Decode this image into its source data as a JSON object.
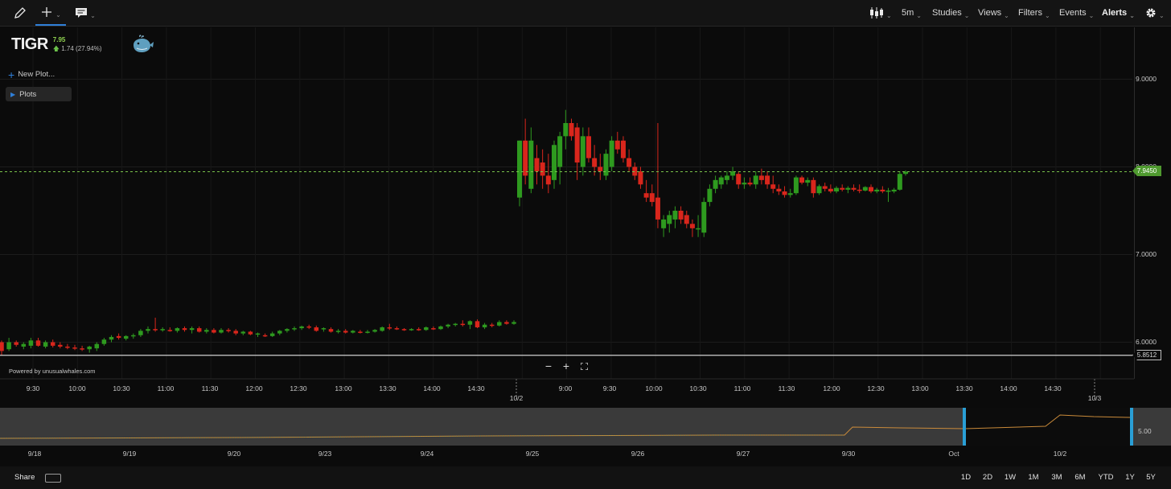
{
  "toolbar": {
    "left_tools": [
      {
        "name": "pencil-icon"
      },
      {
        "name": "crosshair-icon"
      },
      {
        "name": "comment-icon"
      }
    ],
    "interval": "5m",
    "menus": [
      "Studies",
      "Views",
      "Filters",
      "Events",
      "Alerts"
    ]
  },
  "ticker": {
    "symbol": "TIGR",
    "price": "7.95",
    "change": "1.74 (27.94%)",
    "direction": "up"
  },
  "panel": {
    "new_plot_label": "New Plot...",
    "plots_label": "Plots"
  },
  "powered_by": "Powered by unusualwhales.com",
  "zoom": {
    "minus": "−",
    "plus": "+"
  },
  "price_axis": {
    "ticks": [
      "9.0000",
      "8.0000",
      "7.0000",
      "6.0000"
    ],
    "last_price_tag": "7.9450",
    "hline_tag": "5.8512"
  },
  "time_axis": {
    "labels": [
      "9:30",
      "10:00",
      "10:30",
      "11:00",
      "11:30",
      "12:00",
      "12:30",
      "13:00",
      "13:30",
      "14:00",
      "14:30",
      "9:00",
      "9:30",
      "10:00",
      "10:30",
      "11:00",
      "11:30",
      "12:00",
      "12:30",
      "13:00",
      "13:30",
      "14:00",
      "14:30"
    ],
    "date_labels": [
      "10/2",
      "10/3"
    ]
  },
  "navigator": {
    "dates": [
      "9/18",
      "9/19",
      "9/20",
      "9/23",
      "9/24",
      "9/25",
      "9/26",
      "9/27",
      "9/30",
      "Oct",
      "10/2"
    ],
    "price_label": "5.00"
  },
  "footer": {
    "share_label": "Share",
    "ranges": [
      "1D",
      "2D",
      "1W",
      "1M",
      "3M",
      "6M",
      "YTD",
      "1Y",
      "5Y"
    ]
  },
  "colors": {
    "up": "#2e9a1f",
    "down": "#d9261c",
    "accent": "#2f7fd8",
    "last_price_line": "#79c34a"
  },
  "chart_data": {
    "type": "candlestick",
    "symbol": "TIGR",
    "interval": "5m",
    "ylim": [
      5.8,
      9.4
    ],
    "last_price": 7.945,
    "horizontal_line": 5.8512,
    "x_range_days": [
      "10/1",
      "10/2"
    ],
    "candles": [
      {
        "o": 6.0,
        "h": 6.02,
        "l": 5.85,
        "c": 5.9
      },
      {
        "o": 5.92,
        "h": 6.05,
        "l": 5.9,
        "c": 6.0
      },
      {
        "o": 6.0,
        "h": 6.02,
        "l": 5.95,
        "c": 5.97
      },
      {
        "o": 5.95,
        "h": 6.0,
        "l": 5.92,
        "c": 5.98
      },
      {
        "o": 5.96,
        "h": 6.05,
        "l": 5.93,
        "c": 6.02
      },
      {
        "o": 6.02,
        "h": 6.05,
        "l": 5.95,
        "c": 5.96
      },
      {
        "o": 5.95,
        "h": 6.02,
        "l": 5.93,
        "c": 6.0
      },
      {
        "o": 6.0,
        "h": 6.03,
        "l": 5.94,
        "c": 5.96
      },
      {
        "o": 5.97,
        "h": 6.0,
        "l": 5.93,
        "c": 5.95
      },
      {
        "o": 5.95,
        "h": 5.98,
        "l": 5.92,
        "c": 5.94
      },
      {
        "o": 5.94,
        "h": 5.97,
        "l": 5.91,
        "c": 5.93
      },
      {
        "o": 5.93,
        "h": 5.96,
        "l": 5.9,
        "c": 5.92
      },
      {
        "o": 5.92,
        "h": 5.96,
        "l": 5.88,
        "c": 5.95
      },
      {
        "o": 5.93,
        "h": 6.0,
        "l": 5.9,
        "c": 5.98
      },
      {
        "o": 5.98,
        "h": 6.05,
        "l": 5.96,
        "c": 6.03
      },
      {
        "o": 6.03,
        "h": 6.08,
        "l": 6.0,
        "c": 6.06
      },
      {
        "o": 6.07,
        "h": 6.1,
        "l": 6.03,
        "c": 6.05
      },
      {
        "o": 6.04,
        "h": 6.08,
        "l": 6.02,
        "c": 6.07
      },
      {
        "o": 6.07,
        "h": 6.1,
        "l": 6.04,
        "c": 6.08
      },
      {
        "o": 6.08,
        "h": 6.15,
        "l": 6.06,
        "c": 6.13
      },
      {
        "o": 6.13,
        "h": 6.18,
        "l": 6.1,
        "c": 6.15
      },
      {
        "o": 6.15,
        "h": 6.28,
        "l": 6.12,
        "c": 6.14
      },
      {
        "o": 6.14,
        "h": 6.17,
        "l": 6.12,
        "c": 6.15
      },
      {
        "o": 6.14,
        "h": 6.17,
        "l": 6.12,
        "c": 6.13
      },
      {
        "o": 6.13,
        "h": 6.17,
        "l": 6.11,
        "c": 6.16
      },
      {
        "o": 6.16,
        "h": 6.18,
        "l": 6.12,
        "c": 6.14
      },
      {
        "o": 6.14,
        "h": 6.18,
        "l": 6.1,
        "c": 6.16
      },
      {
        "o": 6.16,
        "h": 6.18,
        "l": 6.11,
        "c": 6.12
      },
      {
        "o": 6.12,
        "h": 6.16,
        "l": 6.1,
        "c": 6.14
      },
      {
        "o": 6.14,
        "h": 6.16,
        "l": 6.1,
        "c": 6.11
      },
      {
        "o": 6.11,
        "h": 6.16,
        "l": 6.1,
        "c": 6.14
      },
      {
        "o": 6.14,
        "h": 6.16,
        "l": 6.11,
        "c": 6.13
      },
      {
        "o": 6.13,
        "h": 6.15,
        "l": 6.08,
        "c": 6.1
      },
      {
        "o": 6.1,
        "h": 6.13,
        "l": 6.08,
        "c": 6.12
      },
      {
        "o": 6.12,
        "h": 6.13,
        "l": 6.08,
        "c": 6.09
      },
      {
        "o": 6.09,
        "h": 6.11,
        "l": 6.06,
        "c": 6.1
      },
      {
        "o": 6.08,
        "h": 6.1,
        "l": 6.06,
        "c": 6.07
      },
      {
        "o": 6.07,
        "h": 6.12,
        "l": 6.06,
        "c": 6.1
      },
      {
        "o": 6.1,
        "h": 6.14,
        "l": 6.08,
        "c": 6.13
      },
      {
        "o": 6.13,
        "h": 6.16,
        "l": 6.11,
        "c": 6.15
      },
      {
        "o": 6.15,
        "h": 6.18,
        "l": 6.13,
        "c": 6.16
      },
      {
        "o": 6.16,
        "h": 6.19,
        "l": 6.14,
        "c": 6.18
      },
      {
        "o": 6.18,
        "h": 6.2,
        "l": 6.15,
        "c": 6.17
      },
      {
        "o": 6.17,
        "h": 6.19,
        "l": 6.12,
        "c": 6.13
      },
      {
        "o": 6.15,
        "h": 6.17,
        "l": 6.12,
        "c": 6.16
      },
      {
        "o": 6.15,
        "h": 6.17,
        "l": 6.11,
        "c": 6.12
      },
      {
        "o": 6.12,
        "h": 6.15,
        "l": 6.1,
        "c": 6.13
      },
      {
        "o": 6.13,
        "h": 6.15,
        "l": 6.1,
        "c": 6.11
      },
      {
        "o": 6.11,
        "h": 6.14,
        "l": 6.1,
        "c": 6.13
      },
      {
        "o": 6.12,
        "h": 6.14,
        "l": 6.1,
        "c": 6.11
      },
      {
        "o": 6.11,
        "h": 6.14,
        "l": 6.1,
        "c": 6.12
      },
      {
        "o": 6.12,
        "h": 6.15,
        "l": 6.11,
        "c": 6.14
      },
      {
        "o": 6.13,
        "h": 6.18,
        "l": 6.12,
        "c": 6.17
      },
      {
        "o": 6.17,
        "h": 6.21,
        "l": 6.14,
        "c": 6.16
      },
      {
        "o": 6.16,
        "h": 6.18,
        "l": 6.14,
        "c": 6.15
      },
      {
        "o": 6.15,
        "h": 6.16,
        "l": 6.13,
        "c": 6.14
      },
      {
        "o": 6.14,
        "h": 6.16,
        "l": 6.13,
        "c": 6.15
      },
      {
        "o": 6.15,
        "h": 6.17,
        "l": 6.13,
        "c": 6.14
      },
      {
        "o": 6.14,
        "h": 6.18,
        "l": 6.13,
        "c": 6.17
      },
      {
        "o": 6.16,
        "h": 6.18,
        "l": 6.14,
        "c": 6.15
      },
      {
        "o": 6.15,
        "h": 6.19,
        "l": 6.14,
        "c": 6.18
      },
      {
        "o": 6.18,
        "h": 6.21,
        "l": 6.16,
        "c": 6.2
      },
      {
        "o": 6.2,
        "h": 6.22,
        "l": 6.18,
        "c": 6.21
      },
      {
        "o": 6.21,
        "h": 6.25,
        "l": 6.18,
        "c": 6.2
      },
      {
        "o": 6.2,
        "h": 6.25,
        "l": 6.15,
        "c": 6.24
      },
      {
        "o": 6.24,
        "h": 6.26,
        "l": 6.16,
        "c": 6.17
      },
      {
        "o": 6.17,
        "h": 6.22,
        "l": 6.15,
        "c": 6.2
      },
      {
        "o": 6.2,
        "h": 6.22,
        "l": 6.17,
        "c": 6.19
      },
      {
        "o": 6.19,
        "h": 6.25,
        "l": 6.18,
        "c": 6.23
      },
      {
        "o": 6.23,
        "h": 6.25,
        "l": 6.2,
        "c": 6.21
      },
      {
        "o": 6.21,
        "h": 6.25,
        "l": 6.2,
        "c": 6.23
      },
      {
        "o": 7.65,
        "h": 8.3,
        "l": 7.55,
        "c": 8.3
      },
      {
        "o": 8.3,
        "h": 8.55,
        "l": 7.8,
        "c": 7.9
      },
      {
        "o": 7.75,
        "h": 8.45,
        "l": 7.7,
        "c": 8.3
      },
      {
        "o": 8.1,
        "h": 8.25,
        "l": 7.8,
        "c": 7.95
      },
      {
        "o": 8.05,
        "h": 8.2,
        "l": 7.75,
        "c": 7.9
      },
      {
        "o": 7.9,
        "h": 8.15,
        "l": 7.7,
        "c": 7.8
      },
      {
        "o": 7.85,
        "h": 8.3,
        "l": 7.75,
        "c": 8.25
      },
      {
        "o": 8.0,
        "h": 8.4,
        "l": 7.8,
        "c": 8.35
      },
      {
        "o": 8.35,
        "h": 8.65,
        "l": 8.2,
        "c": 8.5
      },
      {
        "o": 8.5,
        "h": 8.55,
        "l": 8.3,
        "c": 8.35
      },
      {
        "o": 8.45,
        "h": 8.5,
        "l": 7.85,
        "c": 8.05
      },
      {
        "o": 8.0,
        "h": 8.45,
        "l": 7.9,
        "c": 8.35
      },
      {
        "o": 8.35,
        "h": 8.45,
        "l": 8.05,
        "c": 8.1
      },
      {
        "o": 8.1,
        "h": 8.25,
        "l": 7.9,
        "c": 8.0
      },
      {
        "o": 8.0,
        "h": 8.15,
        "l": 7.85,
        "c": 7.95
      },
      {
        "o": 7.9,
        "h": 8.2,
        "l": 7.85,
        "c": 8.15
      },
      {
        "o": 8.0,
        "h": 8.35,
        "l": 7.95,
        "c": 8.3
      },
      {
        "o": 8.3,
        "h": 8.4,
        "l": 8.15,
        "c": 8.2
      },
      {
        "o": 8.3,
        "h": 8.35,
        "l": 8.05,
        "c": 8.1
      },
      {
        "o": 8.1,
        "h": 8.2,
        "l": 7.95,
        "c": 8.0
      },
      {
        "o": 8.0,
        "h": 8.05,
        "l": 7.85,
        "c": 7.9
      },
      {
        "o": 7.95,
        "h": 8.0,
        "l": 7.75,
        "c": 7.8
      },
      {
        "o": 7.7,
        "h": 7.85,
        "l": 7.6,
        "c": 7.65
      },
      {
        "o": 7.7,
        "h": 7.8,
        "l": 7.55,
        "c": 7.6
      },
      {
        "o": 7.65,
        "h": 8.5,
        "l": 7.3,
        "c": 7.4
      },
      {
        "o": 7.3,
        "h": 7.45,
        "l": 7.2,
        "c": 7.4
      },
      {
        "o": 7.35,
        "h": 7.5,
        "l": 7.25,
        "c": 7.45
      },
      {
        "o": 7.4,
        "h": 7.55,
        "l": 7.3,
        "c": 7.5
      },
      {
        "o": 7.5,
        "h": 7.55,
        "l": 7.35,
        "c": 7.4
      },
      {
        "o": 7.45,
        "h": 7.5,
        "l": 7.3,
        "c": 7.35
      },
      {
        "o": 7.35,
        "h": 7.4,
        "l": 7.2,
        "c": 7.3
      },
      {
        "o": 7.3,
        "h": 7.45,
        "l": 7.2,
        "c": 7.3
      },
      {
        "o": 7.25,
        "h": 7.65,
        "l": 7.2,
        "c": 7.6
      },
      {
        "o": 7.6,
        "h": 7.8,
        "l": 7.55,
        "c": 7.75
      },
      {
        "o": 7.75,
        "h": 7.9,
        "l": 7.7,
        "c": 7.85
      },
      {
        "o": 7.8,
        "h": 7.9,
        "l": 7.75,
        "c": 7.88
      },
      {
        "o": 7.85,
        "h": 7.95,
        "l": 7.8,
        "c": 7.9
      },
      {
        "o": 7.9,
        "h": 8.0,
        "l": 7.85,
        "c": 7.95
      },
      {
        "o": 7.92,
        "h": 7.95,
        "l": 7.75,
        "c": 7.8
      },
      {
        "o": 7.8,
        "h": 7.88,
        "l": 7.75,
        "c": 7.82
      },
      {
        "o": 7.82,
        "h": 7.88,
        "l": 7.78,
        "c": 7.8
      },
      {
        "o": 7.8,
        "h": 7.95,
        "l": 7.75,
        "c": 7.9
      },
      {
        "o": 7.9,
        "h": 7.98,
        "l": 7.8,
        "c": 7.85
      },
      {
        "o": 7.9,
        "h": 7.95,
        "l": 7.75,
        "c": 7.8
      },
      {
        "o": 7.8,
        "h": 7.9,
        "l": 7.7,
        "c": 7.75
      },
      {
        "o": 7.75,
        "h": 7.8,
        "l": 7.68,
        "c": 7.72
      },
      {
        "o": 7.72,
        "h": 7.78,
        "l": 7.65,
        "c": 7.68
      },
      {
        "o": 7.68,
        "h": 7.75,
        "l": 7.65,
        "c": 7.7
      },
      {
        "o": 7.7,
        "h": 7.9,
        "l": 7.68,
        "c": 7.88
      },
      {
        "o": 7.88,
        "h": 7.9,
        "l": 7.8,
        "c": 7.82
      },
      {
        "o": 7.82,
        "h": 7.88,
        "l": 7.78,
        "c": 7.85
      },
      {
        "o": 7.85,
        "h": 7.88,
        "l": 7.65,
        "c": 7.7
      },
      {
        "o": 7.7,
        "h": 7.8,
        "l": 7.68,
        "c": 7.78
      },
      {
        "o": 7.78,
        "h": 7.82,
        "l": 7.72,
        "c": 7.75
      },
      {
        "o": 7.75,
        "h": 7.8,
        "l": 7.7,
        "c": 7.72
      },
      {
        "o": 7.72,
        "h": 7.78,
        "l": 7.7,
        "c": 7.76
      },
      {
        "o": 7.76,
        "h": 7.8,
        "l": 7.72,
        "c": 7.74
      },
      {
        "o": 7.74,
        "h": 7.78,
        "l": 7.7,
        "c": 7.76
      },
      {
        "o": 7.76,
        "h": 7.8,
        "l": 7.72,
        "c": 7.74
      },
      {
        "o": 7.74,
        "h": 7.8,
        "l": 7.7,
        "c": 7.73
      },
      {
        "o": 7.73,
        "h": 7.78,
        "l": 7.72,
        "c": 7.77
      },
      {
        "o": 7.77,
        "h": 7.8,
        "l": 7.7,
        "c": 7.72
      },
      {
        "o": 7.72,
        "h": 7.76,
        "l": 7.7,
        "c": 7.74
      },
      {
        "o": 7.74,
        "h": 7.78,
        "l": 7.7,
        "c": 7.72
      },
      {
        "o": 7.72,
        "h": 7.76,
        "l": 7.6,
        "c": 7.73
      },
      {
        "o": 7.72,
        "h": 7.76,
        "l": 7.7,
        "c": 7.74
      },
      {
        "o": 7.74,
        "h": 7.95,
        "l": 7.73,
        "c": 7.92
      },
      {
        "o": 7.92,
        "h": 7.96,
        "l": 7.9,
        "c": 7.945
      }
    ]
  }
}
